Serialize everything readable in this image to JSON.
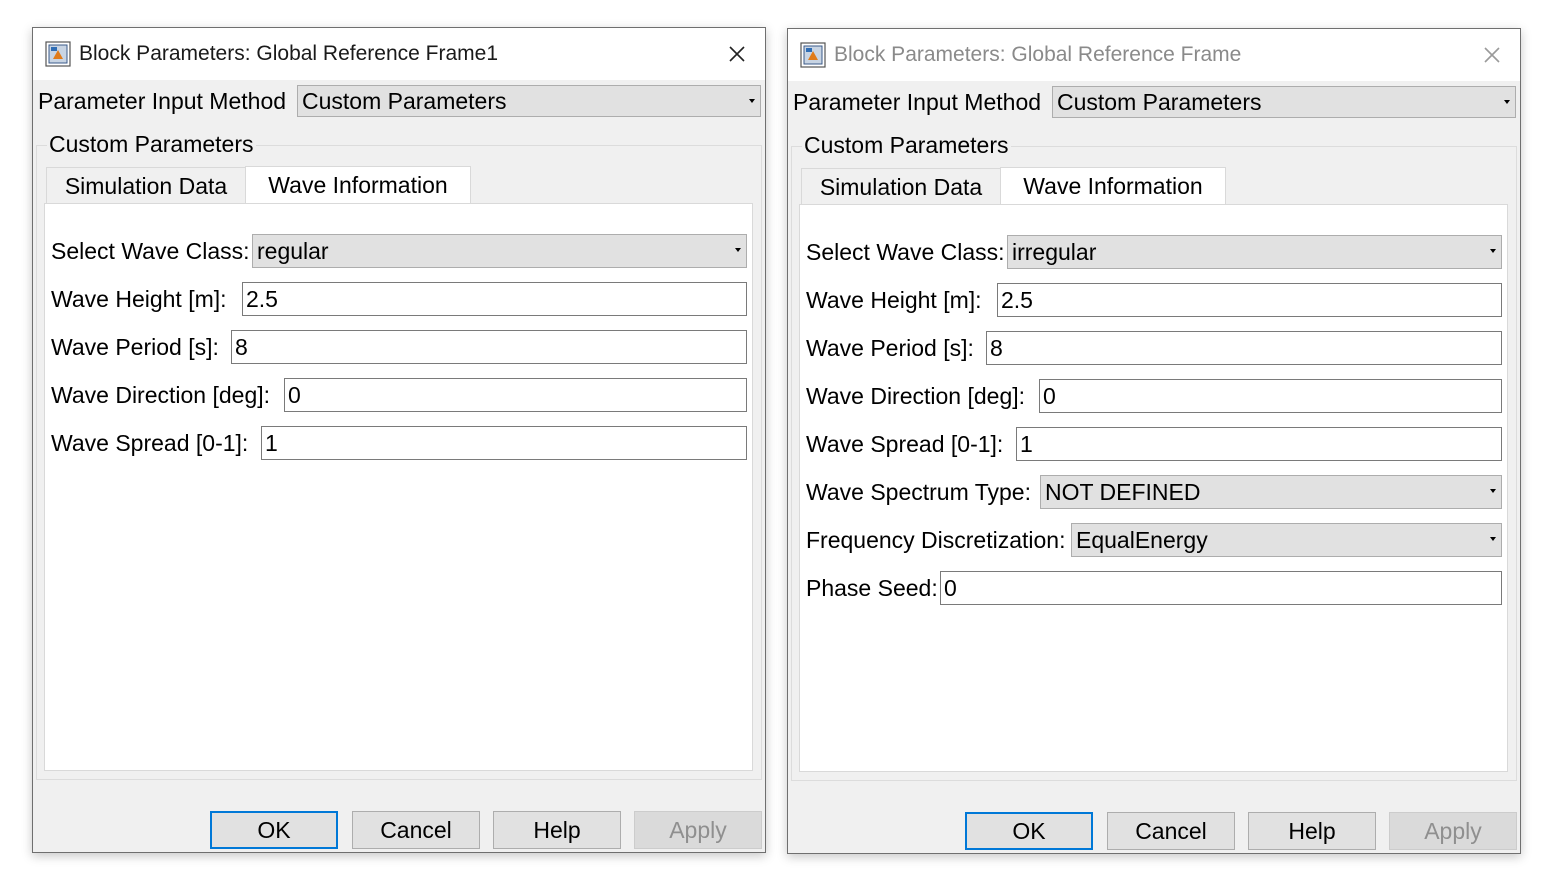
{
  "dialogs": [
    {
      "title": "Block Parameters: Global Reference Frame1",
      "parameter_input_method_label": "Parameter Input Method",
      "parameter_input_method_value": "Custom Parameters",
      "group_label": "Custom Parameters",
      "tabs": [
        "Simulation Data",
        "Wave Information"
      ],
      "active_tab": "Wave Information",
      "fields": {
        "wave_class": {
          "label": "Select Wave Class:",
          "value": "regular"
        },
        "wave_height": {
          "label": "Wave Height [m]:",
          "value": "2.5"
        },
        "wave_period": {
          "label": "Wave Period [s]:",
          "value": "8"
        },
        "wave_direction": {
          "label": "Wave Direction [deg]:",
          "value": "0"
        },
        "wave_spread": {
          "label": "Wave Spread [0-1]:",
          "value": "1"
        }
      },
      "buttons": {
        "ok": "OK",
        "cancel": "Cancel",
        "help": "Help",
        "apply": "Apply"
      }
    },
    {
      "title": "Block Parameters: Global Reference Frame",
      "parameter_input_method_label": "Parameter Input Method",
      "parameter_input_method_value": "Custom Parameters",
      "group_label": "Custom Parameters",
      "tabs": [
        "Simulation Data",
        "Wave Information"
      ],
      "active_tab": "Wave Information",
      "fields": {
        "wave_class": {
          "label": "Select Wave Class:",
          "value": "irregular"
        },
        "wave_height": {
          "label": "Wave Height [m]:",
          "value": "2.5"
        },
        "wave_period": {
          "label": "Wave Period [s]:",
          "value": "8"
        },
        "wave_direction": {
          "label": "Wave Direction [deg]:",
          "value": "0"
        },
        "wave_spread": {
          "label": "Wave Spread [0-1]:",
          "value": "1"
        },
        "spectrum_type": {
          "label": "Wave Spectrum Type:",
          "value": "NOT DEFINED"
        },
        "freq_discretization": {
          "label": "Frequency Discretization:",
          "value": "EqualEnergy"
        },
        "phase_seed": {
          "label": "Phase Seed:",
          "value": "0"
        }
      },
      "buttons": {
        "ok": "OK",
        "cancel": "Cancel",
        "help": "Help",
        "apply": "Apply"
      }
    }
  ],
  "colors": {
    "default_button_border": "#0078d7",
    "dialog_bg": "#f0f0f0",
    "disabled_text": "#8f8f8f"
  },
  "icons": {
    "title_icon": "simulink-block-icon",
    "close_icon": "close-icon",
    "dropdown_icon": "chevron-down-icon"
  }
}
